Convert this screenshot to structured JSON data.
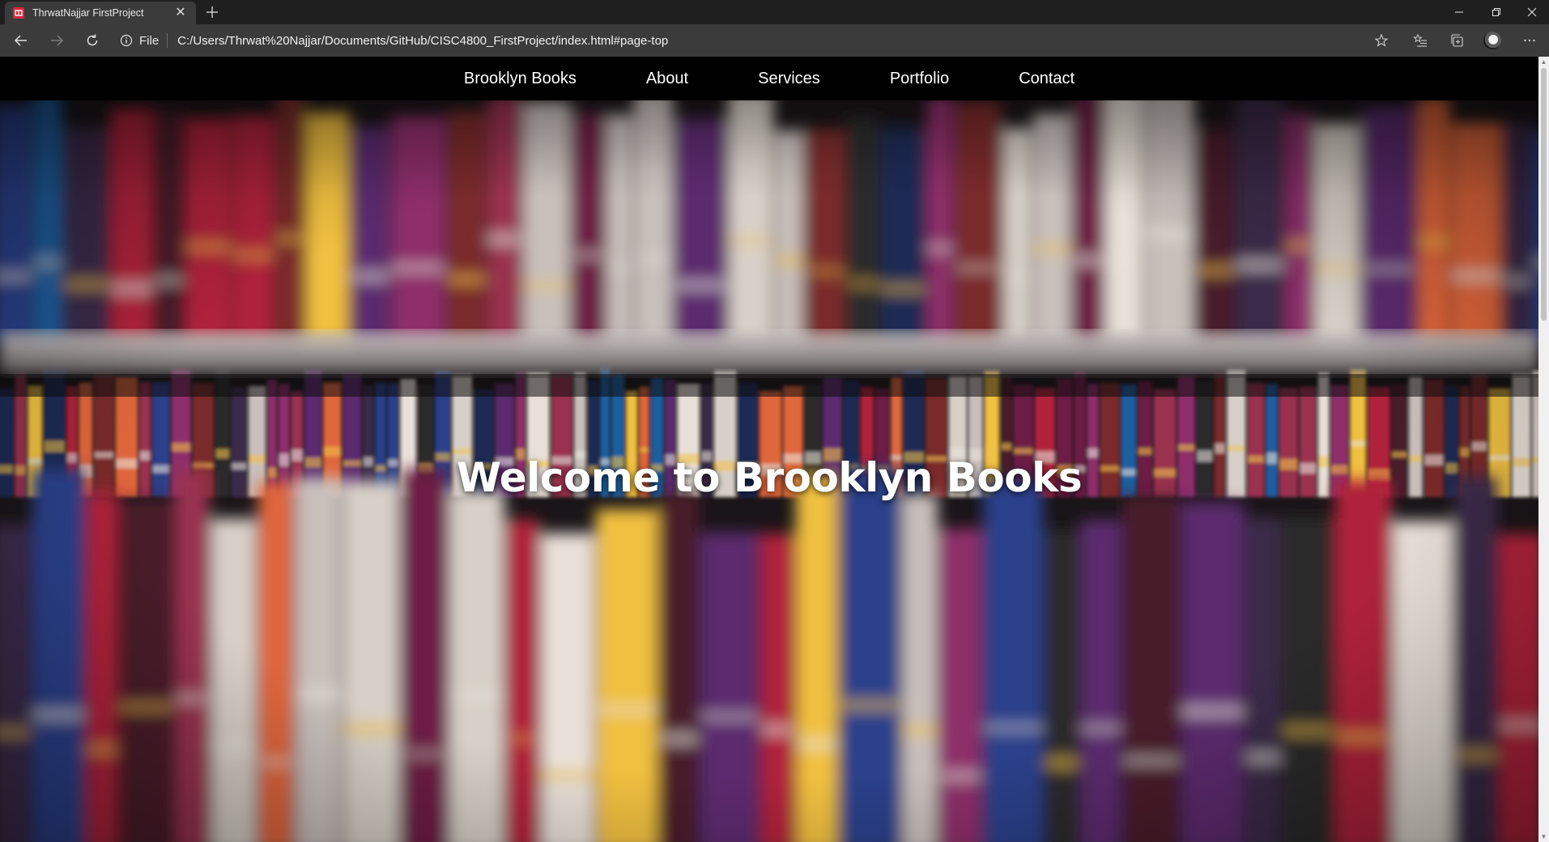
{
  "browser": {
    "tab": {
      "title": "ThrwatNajjar FirstProject"
    },
    "address": {
      "scheme_label": "File",
      "url": "C:/Users/Thrwat%20Najjar/Documents/GitHub/CISC4800_FirstProject/index.html#page-top"
    }
  },
  "site_nav": {
    "items": [
      "Brooklyn Books",
      "About",
      "Services",
      "Portfolio",
      "Contact"
    ]
  },
  "hero": {
    "title": "Welcome to Brooklyn Books"
  },
  "colors": {
    "nav_background": "#000000",
    "nav_text": "#ffffff",
    "tab_favicon": "#d7263d"
  }
}
